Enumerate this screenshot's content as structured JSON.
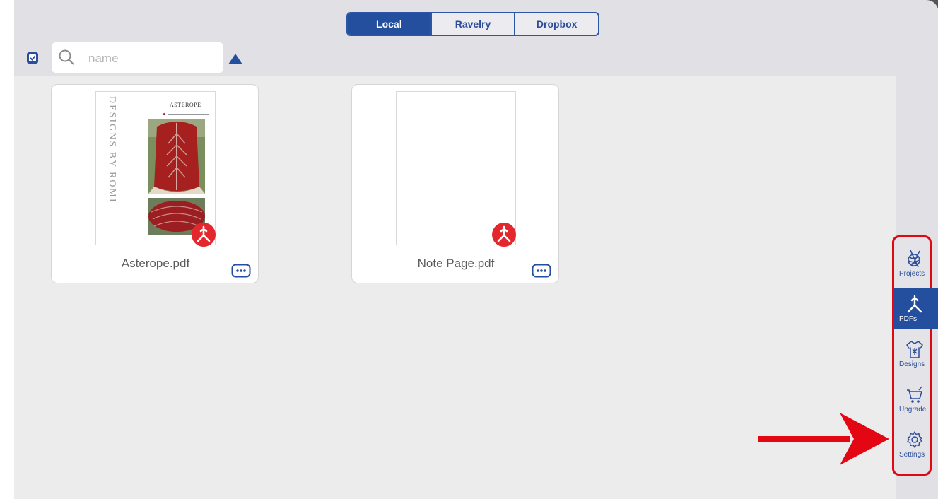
{
  "tabs_top": {
    "options": [
      "Local",
      "Ravelry",
      "Dropbox"
    ],
    "selected": "Local"
  },
  "search": {
    "placeholder": "name",
    "value": ""
  },
  "files": [
    {
      "name": "Asterope.pdf",
      "thumbnail": {
        "side_text": "DESIGNS BY ROMI",
        "title": "ASTEROPE"
      }
    },
    {
      "name": "Note Page.pdf"
    }
  ],
  "side_nav": {
    "items": [
      {
        "label": "Projects",
        "icon": "yarn-ball-icon"
      },
      {
        "label": "PDFs",
        "icon": "pdf-icon",
        "active": true
      },
      {
        "label": "Designs",
        "icon": "sweater-icon"
      },
      {
        "label": "Upgrade",
        "icon": "cart-icon"
      },
      {
        "label": "Settings",
        "icon": "gear-icon"
      }
    ]
  },
  "colors": {
    "accent": "#244f9e",
    "pdf_red": "#e3272d",
    "highlight_red": "#e30613",
    "toolbar_bg": "#e1e1e5",
    "content_bg": "#ececec"
  }
}
